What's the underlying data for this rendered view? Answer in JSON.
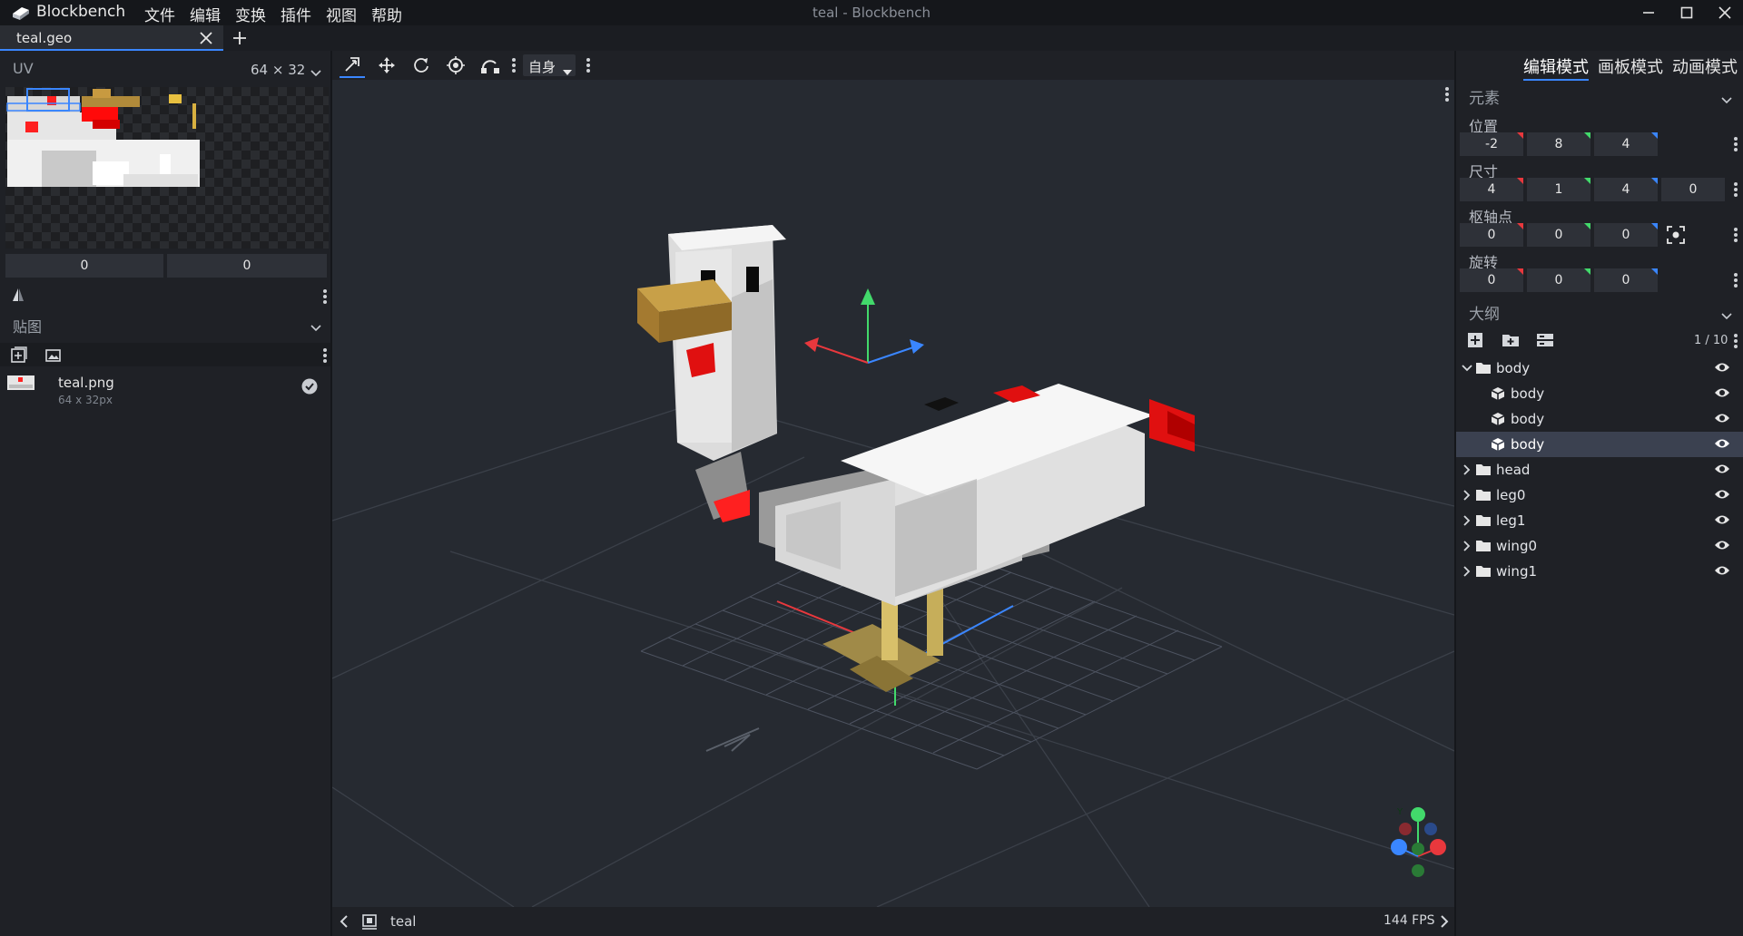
{
  "titlebar": {
    "app_name": "Blockbench",
    "menus": [
      "文件",
      "编辑",
      "变换",
      "插件",
      "视图",
      "帮助"
    ],
    "window_title": "teal - Blockbench"
  },
  "tabs": [
    {
      "label": "teal.geo"
    }
  ],
  "uv_panel": {
    "title": "UV",
    "size": "64 × 32",
    "values": [
      "0",
      "0"
    ]
  },
  "textures": {
    "title": "贴图",
    "items": [
      {
        "name": "teal.png",
        "size": "64 x 32px"
      }
    ]
  },
  "toolbar": {
    "space_label": "自身"
  },
  "modes": [
    "编辑模式",
    "画板模式",
    "动画模式"
  ],
  "element": {
    "title": "元素",
    "rows": [
      {
        "label": "位置",
        "values": [
          "-2",
          "8",
          "4"
        ]
      },
      {
        "label": "尺寸",
        "values": [
          "4",
          "1",
          "4",
          "0"
        ]
      },
      {
        "label": "枢轴点",
        "values": [
          "0",
          "0",
          "0"
        ]
      },
      {
        "label": "旋转",
        "values": [
          "0",
          "0",
          "0"
        ]
      }
    ]
  },
  "outliner": {
    "title": "大纲",
    "count": "1 / 10",
    "items": [
      {
        "name": "body",
        "type": "group",
        "expanded": true,
        "level": 0
      },
      {
        "name": "body",
        "type": "cube",
        "level": 1
      },
      {
        "name": "body",
        "type": "cube",
        "level": 1
      },
      {
        "name": "body",
        "type": "cube",
        "level": 1,
        "selected": true
      },
      {
        "name": "head",
        "type": "group",
        "level": 0
      },
      {
        "name": "leg0",
        "type": "group",
        "level": 0
      },
      {
        "name": "leg1",
        "type": "group",
        "level": 0
      },
      {
        "name": "wing0",
        "type": "group",
        "level": 0
      },
      {
        "name": "wing1",
        "type": "group",
        "level": 0
      }
    ]
  },
  "statusbar": {
    "model_name": "teal",
    "fps": "144 FPS"
  },
  "colors": {
    "accent": "#3a86ff",
    "axis_x": "#e8383d",
    "axis_y": "#42d96b",
    "axis_z": "#3a86ff"
  }
}
